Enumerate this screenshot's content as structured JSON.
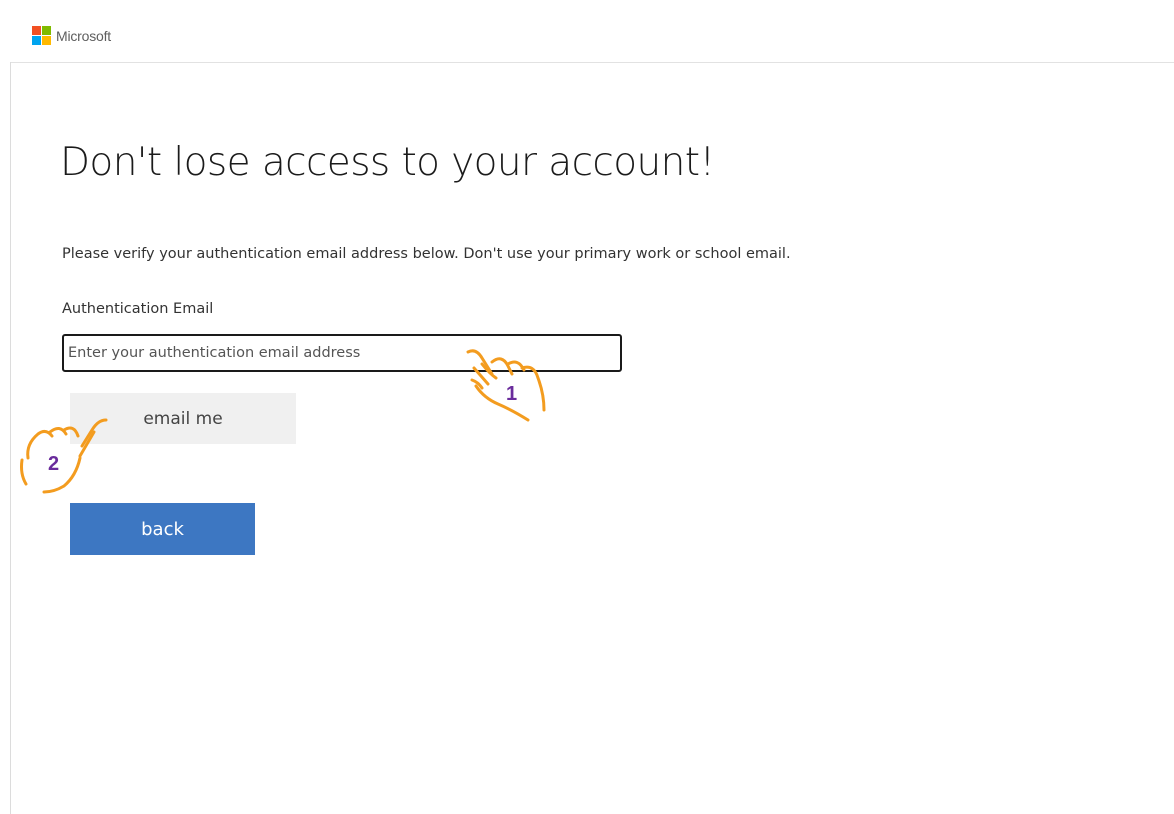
{
  "header": {
    "brand_name": "Microsoft",
    "logo_colors": [
      "#f25022",
      "#7fba00",
      "#00a4ef",
      "#ffb900"
    ]
  },
  "main": {
    "title": "Don't lose access to your account!",
    "instructions": "Please verify your authentication email address below. Don't use your primary work or school email.",
    "field_label": "Authentication Email",
    "email_placeholder": "Enter your authentication email address",
    "email_value": "",
    "email_me_label": "email me",
    "back_label": "back"
  },
  "annotations": {
    "step1": "1",
    "step2": "2",
    "hand_color": "#f39c1f",
    "number_color": "#6a2c9c"
  }
}
